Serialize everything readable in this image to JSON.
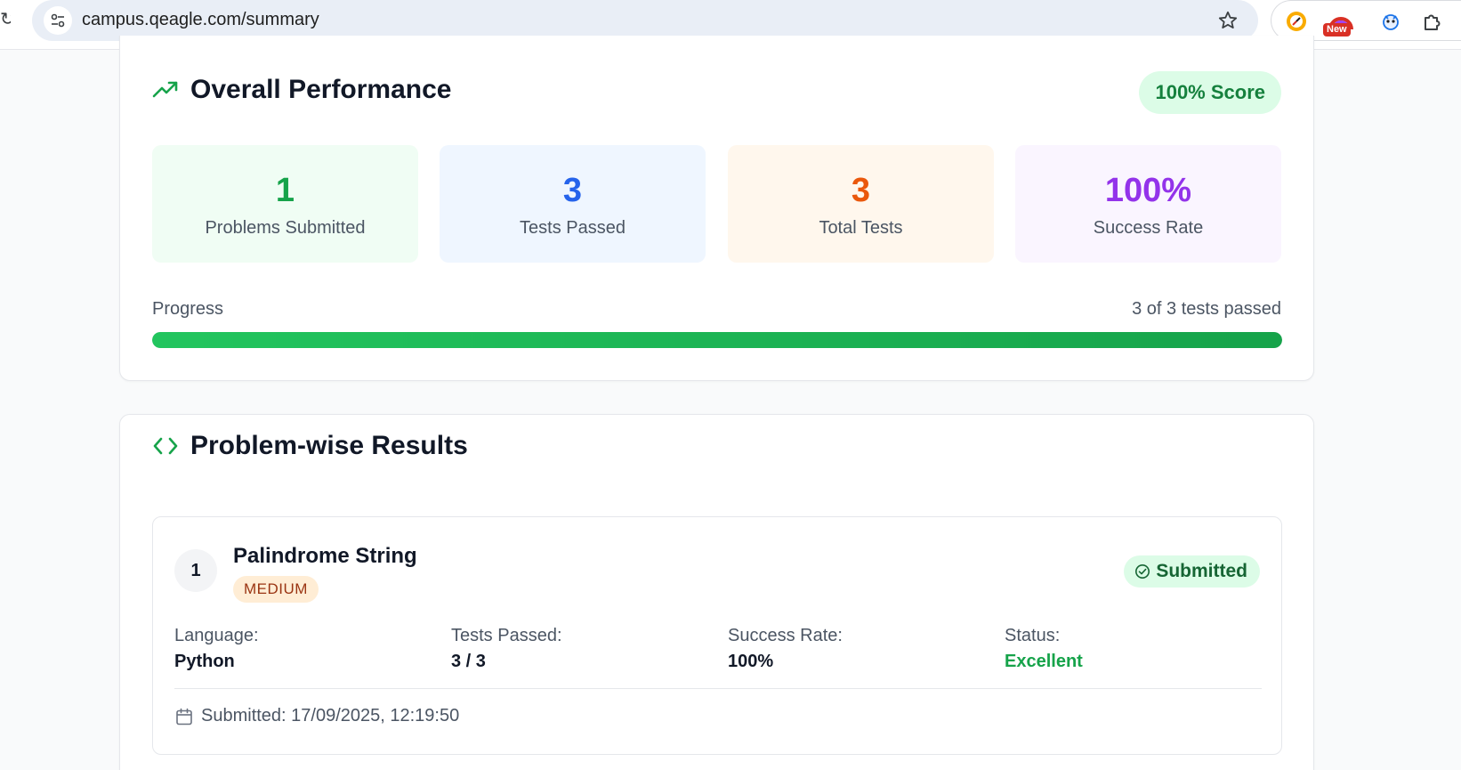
{
  "browser": {
    "url": "campus.qeagle.com/summary",
    "extension_badge": "New"
  },
  "performance": {
    "title": "Overall Performance",
    "score_badge": "100% Score",
    "stats": [
      {
        "value": "1",
        "label": "Problems Submitted",
        "color": "#16a34a"
      },
      {
        "value": "3",
        "label": "Tests Passed",
        "color": "#2563eb"
      },
      {
        "value": "3",
        "label": "Total Tests",
        "color": "#ea580c"
      },
      {
        "value": "100%",
        "label": "Success Rate",
        "color": "#9333ea"
      }
    ],
    "progress": {
      "label": "Progress",
      "count_text": "3 of 3 tests passed",
      "fraction": 1.0
    }
  },
  "problems": {
    "title": "Problem-wise Results",
    "items": [
      {
        "number": "1",
        "name": "Palindrome String",
        "difficulty": "MEDIUM",
        "status_badge": "Submitted",
        "language_label": "Language:",
        "language": "Python",
        "tests_label": "Tests Passed:",
        "tests": "3 / 3",
        "rate_label": "Success Rate:",
        "rate": "100%",
        "status_label": "Status:",
        "status": "Excellent",
        "submitted_at": "Submitted: 17/09/2025, 12:19:50"
      }
    ]
  },
  "colors": {
    "accent_green": "#16a34a",
    "progress_green": "#22c55e"
  }
}
